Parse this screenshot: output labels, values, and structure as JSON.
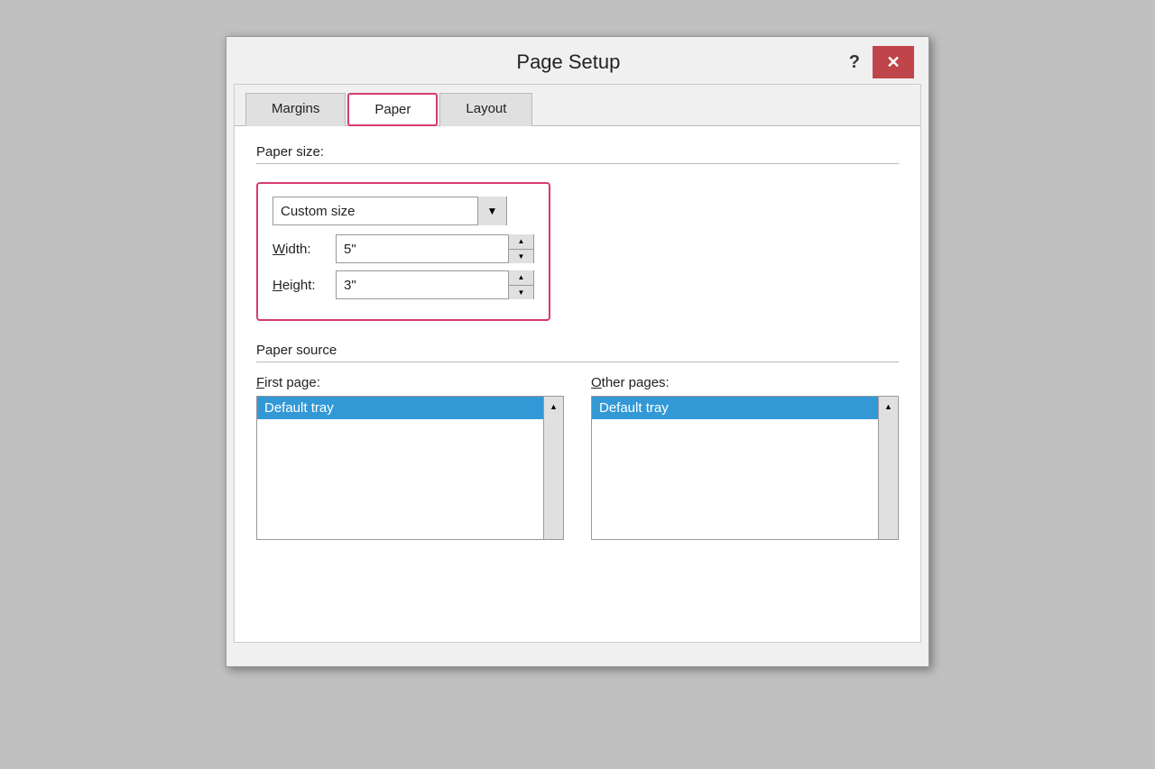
{
  "dialog": {
    "title": "Page Setup",
    "help_label": "?",
    "close_label": "×"
  },
  "tabs": [
    {
      "id": "margins",
      "label": "Margins",
      "active": false,
      "highlighted": false
    },
    {
      "id": "paper",
      "label": "Paper",
      "active": true,
      "highlighted": true
    },
    {
      "id": "layout",
      "label": "Layout",
      "active": false,
      "highlighted": false
    }
  ],
  "paper_size": {
    "section_label": "Paper size:",
    "selected_value": "Custom size",
    "width_label": "Width:",
    "width_value": "5\"",
    "height_label": "Height:",
    "height_value": "3\""
  },
  "paper_source": {
    "section_label": "Paper source",
    "first_page": {
      "label": "First page:",
      "selected": "Default tray"
    },
    "other_pages": {
      "label": "Other pages:",
      "selected": "Default tray"
    }
  },
  "icons": {
    "chevron_down": "▼",
    "spin_up": "▲",
    "spin_down": "▼",
    "scroll_up": "▲",
    "scroll_down": "▼",
    "close": "✕"
  }
}
